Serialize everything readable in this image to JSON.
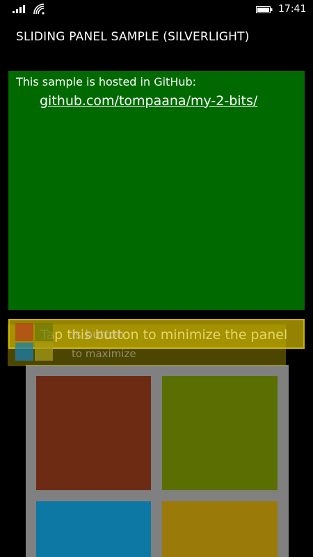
{
  "status_bar": {
    "time": "17:41",
    "icons": [
      "signal-strength-icon",
      "wifi-icon",
      "battery-icon"
    ]
  },
  "app": {
    "title": "SLIDING PANEL SAMPLE (SILVERLIGHT)"
  },
  "panel": {
    "caption": "This sample is hosted in GitHub:",
    "link_text": "github.com/tompaana/my-2-bits/",
    "background_color": "#006a00"
  },
  "minimize_button": {
    "label": "Tap this button to minimize the panel",
    "color": "#bea800"
  },
  "ghost_button": {
    "label_line1": "Is button",
    "label_line2": "to maximize"
  },
  "tiles": {
    "colors": [
      "#6e2b14",
      "#5a6e02",
      "#0e78a4",
      "#9a7a08"
    ],
    "board_color": "#808080"
  }
}
